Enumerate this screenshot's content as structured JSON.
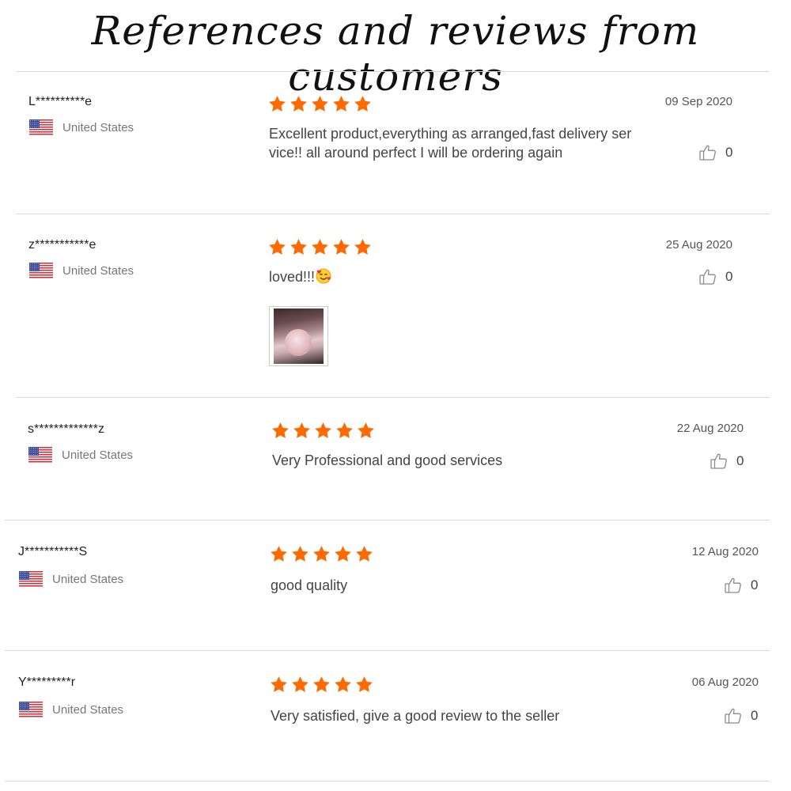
{
  "page": {
    "title": "References and reviews from customers"
  },
  "reviews": [
    {
      "reviewer": "L**********e",
      "country": "United States",
      "rating": 5,
      "content": [
        "Excellent product,everything as arranged,fast delivery ser",
        "vice!! all around perfect I will be ordering again"
      ],
      "date": "09 Sep 2020",
      "likes": "0"
    },
    {
      "reviewer": "z***********e",
      "country": "United States",
      "rating": 5,
      "content": [
        "loved!!!"
      ],
      "date": "25 Aug 2020",
      "likes": "0",
      "has_photo": true
    },
    {
      "reviewer": "s*************z",
      "country": "United States",
      "rating": 5,
      "content": [
        "Very Professional and good services"
      ],
      "date": "22 Aug 2020",
      "likes": "0"
    },
    {
      "reviewer": "J***********S",
      "country": "United States",
      "rating": 5,
      "content": [
        "good quality"
      ],
      "date": "12 Aug 2020",
      "likes": "0"
    },
    {
      "reviewer": "Y*********r",
      "country": "United States",
      "rating": 5,
      "content": [
        "Very satisfied, give a good review to the seller"
      ],
      "date": "06 Aug 2020",
      "likes": "0"
    }
  ],
  "icons": {
    "star": "star-icon",
    "flag": "us-flag-icon",
    "like": "thumbs-up-icon",
    "emoji": "smiling-face-with-hearts-emoji"
  },
  "colors": {
    "star": "#ff6a00",
    "divider": "#d9d9d9",
    "country_text": "#777777"
  }
}
